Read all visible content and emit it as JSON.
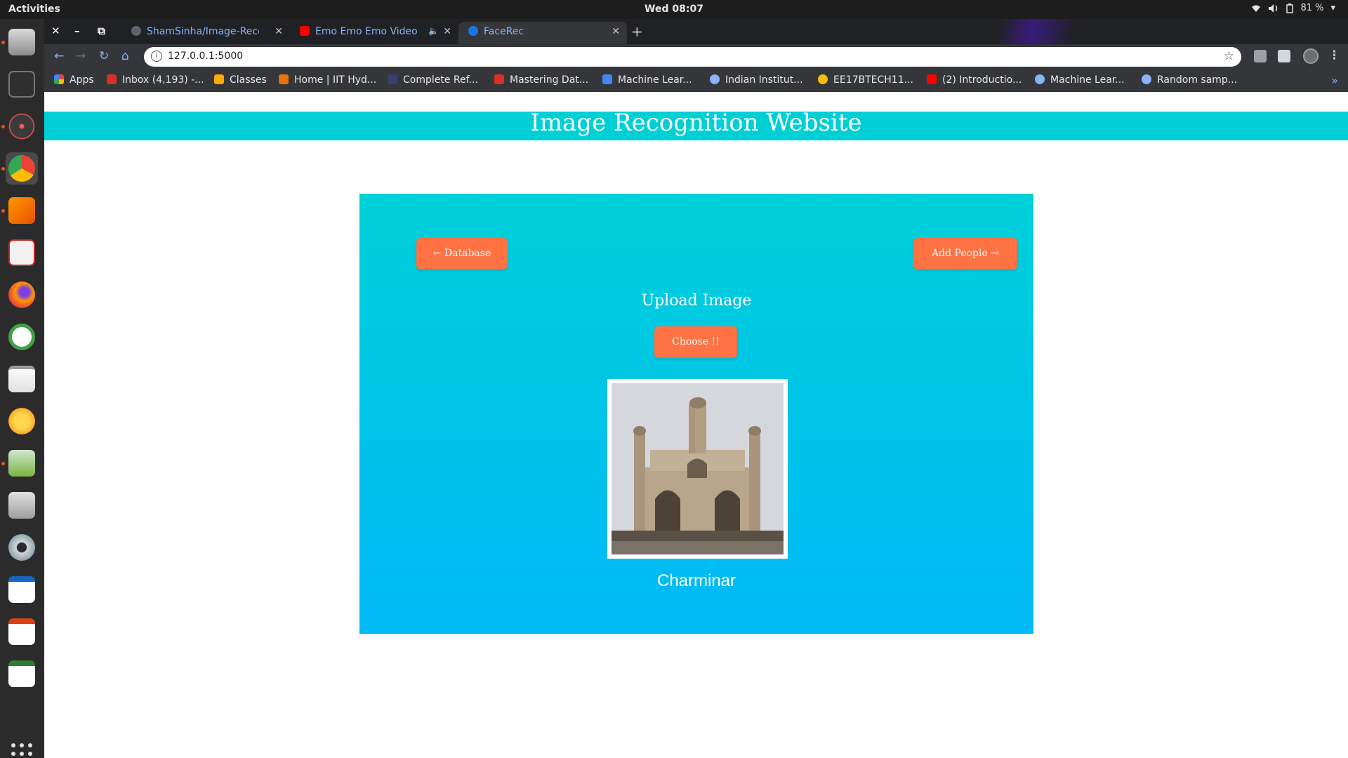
{
  "topbar": {
    "activities": "Activities",
    "clock": "Wed 08:07",
    "battery": "81 %"
  },
  "dock": {
    "apps": [
      "files",
      "terminal",
      "network-tool",
      "chrome",
      "sublime-text",
      "pdf-viewer",
      "firefox",
      "app-circle",
      "text-editor",
      "teapot-app",
      "image-viewer",
      "software-center",
      "settings",
      "writer",
      "impress",
      "calc"
    ]
  },
  "browser": {
    "tabs": [
      {
        "title": "ShamSinha/Image-Recog",
        "icon": "github-icon"
      },
      {
        "title": "Emo Emo Emo Video S",
        "icon": "youtube-icon"
      },
      {
        "title": "FaceRec",
        "icon": "globe-icon"
      }
    ],
    "url": "127.0.0.1:5000",
    "bookmarks": [
      {
        "label": "Apps",
        "color": "#ea4335"
      },
      {
        "label": "Inbox (4,193) -...",
        "color": "#d93025"
      },
      {
        "label": "Classes",
        "color": "#f9ab00"
      },
      {
        "label": "Home | IIT Hyd...",
        "color": "#e8710a"
      },
      {
        "label": "Complete Ref...",
        "color": "#3c3c6e"
      },
      {
        "label": "Mastering Dat...",
        "color": "#d93025"
      },
      {
        "label": "Machine Lear...",
        "color": "#4285f4"
      },
      {
        "label": "Indian Institut...",
        "color": "#8ab4f8"
      },
      {
        "label": "EE17BTECH11...",
        "color": "#fbbc04"
      },
      {
        "label": "(2) Introductio...",
        "color": "#ff0000"
      },
      {
        "label": "Machine Lear...",
        "color": "#8ab4f8"
      },
      {
        "label": "Random samp...",
        "color": "#8ab4f8"
      }
    ]
  },
  "site": {
    "title": "Image Recognition Website",
    "database_btn": "← Database",
    "add_people_btn": "Add People →",
    "upload_title": "Upload Image",
    "choose_btn": "Choose !!",
    "result": "Charminar",
    "accent": "#00cfd6",
    "button_color": "#ff7243"
  }
}
